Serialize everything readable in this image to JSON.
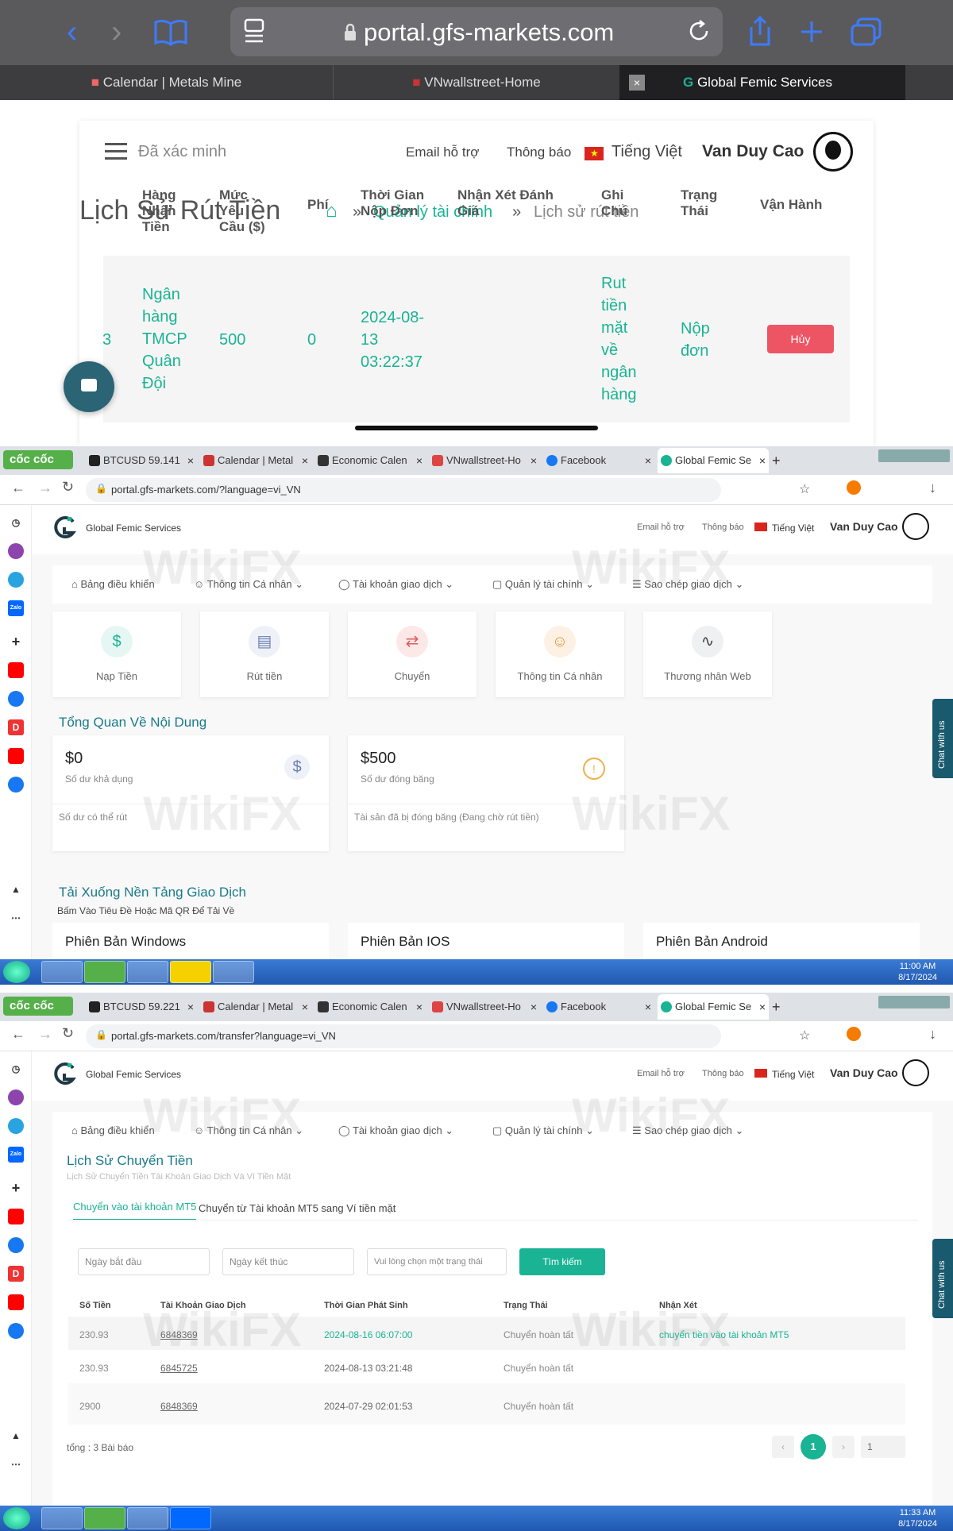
{
  "ipad": {
    "url": "portal.gfs-markets.com",
    "tabs": [
      {
        "label": "Calendar | Metals Mine"
      },
      {
        "label": "VNwallstreet-Home"
      },
      {
        "label": "Global Femic Services"
      }
    ],
    "header": {
      "verified": "Đã xác minh",
      "email_support": "Email hỗ trợ",
      "notifications": "Thông báo",
      "language": "Tiếng Việt",
      "user": "Van Duy Cao"
    },
    "page_title": "Lịch Sử Rút Tiền",
    "breadcrumb": [
      "Quản lý tài chính",
      "Lịch sử rút tiền"
    ],
    "breadcrumb_sep": "»",
    "table": {
      "headers": [
        "Hàng Nhận Tiền",
        "Mức Yêu Cầu ($)",
        "Phí",
        "Thời Gian Nộp Đơn",
        "Nhận Xét Đánh Giá",
        "Ghi Chú",
        "Trạng Thái",
        "Vận Hành"
      ],
      "row": {
        "index": "3",
        "bank": "Ngân hàng TMCP Quân Đội",
        "amount": "500",
        "fee": "0",
        "time": "2024-08-13 03:22:37",
        "review": "",
        "note": "Rut tiền mặt về ngân hàng",
        "status": "Nộp đơn",
        "action": "Hủy"
      }
    }
  },
  "browser_tabs": [
    "BTCUSD 59.141",
    "Calendar | Metal",
    "Economic Calen",
    "VNwallstreet-Ho",
    "Facebook",
    "Global Femic Se"
  ],
  "browser_tabs_2": [
    "BTCUSD 59.221",
    "Calendar | Metal",
    "Economic Calen",
    "VNwallstreet-Ho",
    "Facebook",
    "Global Femic Se"
  ],
  "coc_coc": "cốc cốc",
  "dashboard": {
    "url": "portal.gfs-markets.com/?language=vi_VN",
    "brand": "Global Femic Services",
    "email_support": "Email hỗ trợ",
    "notifications": "Thông báo",
    "language": "Tiếng Việt",
    "user": "Van Duy Cao",
    "menu": [
      "Bảng điều khiển",
      "Thông tin Cá nhân",
      "Tài khoản giao dịch",
      "Quản lý tài chính",
      "Sao chép giao dịch"
    ],
    "quick": [
      "Nạp Tiền",
      "Rút tiền",
      "Chuyển",
      "Thông tin Cá nhân",
      "Thương nhân Web"
    ],
    "overview_title": "Tổng Quan Về Nội Dung",
    "balance": {
      "value": "$0",
      "label": "Số dư khả dụng",
      "foot": "Số dư có thể rút"
    },
    "frozen": {
      "value": "$500",
      "label": "Số dư đóng băng",
      "foot": "Tài sản đã bị đóng băng (Đang chờ rút tiền)"
    },
    "download_title": "Tải Xuống Nền Tảng Giao Dịch",
    "download_sub": "Bấm Vào Tiêu Đề Hoặc Mã QR Để Tải Về",
    "platforms": [
      "Phiên Bản Windows",
      "Phiên Bản IOS",
      "Phiên Bản Android"
    ],
    "chat": "Chat with us",
    "clock_time": "11:00 AM",
    "clock_date": "8/17/2024"
  },
  "transfer": {
    "url": "portal.gfs-markets.com/transfer?language=vi_VN",
    "title": "Lịch Sử Chuyển Tiền",
    "subtitle": "Lịch Sử Chuyển Tiền Tài Khoản Giao Dịch Và Ví Tiền Mặt",
    "tabs": [
      "Chuyển vào tài khoản MT5",
      "Chuyển từ Tài khoản MT5 sang Ví tiền mặt"
    ],
    "filters": {
      "start": "Ngày bắt đầu",
      "end": "Ngày kết thúc",
      "status": "Vui lòng chọn một trạng thái",
      "search": "Tìm kiếm"
    },
    "headers": [
      "Số Tiền",
      "Tài Khoản Giao Dịch",
      "Thời Gian Phát Sinh",
      "Trạng Thái",
      "Nhận Xét"
    ],
    "rows": [
      {
        "amount": "230.93",
        "account": "6848369",
        "time": "2024-08-16 06:07:00",
        "status": "Chuyển hoàn tất",
        "note": "chuyển tiền vào tài khoản MT5"
      },
      {
        "amount": "230.93",
        "account": "6845725",
        "time": "2024-08-13 03:21:48",
        "status": "Chuyển hoàn tất",
        "note": ""
      },
      {
        "amount": "2900",
        "account": "6848369",
        "time": "2024-07-29 02:01:53",
        "status": "Chuyển hoàn tất",
        "note": ""
      }
    ],
    "total": "tổng : 3 Bài báo",
    "page": "1",
    "page_input": "1",
    "clock_time": "11:33 AM",
    "clock_date": "8/17/2024"
  },
  "watermark": "WikiFX",
  "colors": {
    "accent": "#1ab394",
    "danger": "#ed5565",
    "teal_dark": "#1a7a8a"
  }
}
